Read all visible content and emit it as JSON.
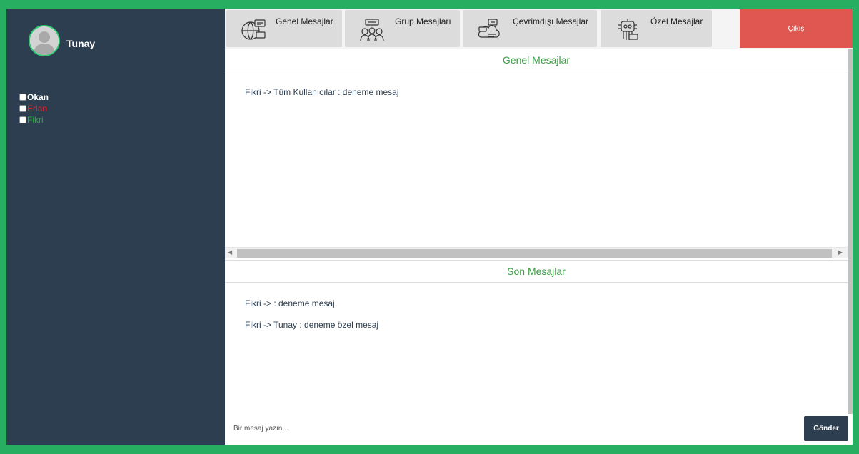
{
  "colors": {
    "page_border": "#27ae60",
    "sidebar_bg": "#2c3e50",
    "accent_green": "#3c9d46",
    "logout_red": "#e05650"
  },
  "profile": {
    "name": "Tunay",
    "avatar_icon": "user-silhouette-icon"
  },
  "users": [
    {
      "name": "Okan",
      "color": "#ffffff",
      "bold": true
    },
    {
      "name": "Erlan",
      "color": "#e8242b",
      "bold": false
    },
    {
      "name": "Fikri",
      "color": "#26b22f",
      "bold": false
    }
  ],
  "tabs": [
    {
      "label": "Genel Mesajlar",
      "icon": "globe-chat-icon"
    },
    {
      "label": "Grup Mesajları",
      "icon": "group-chat-icon"
    },
    {
      "label": "Çevrimdışı Mesajlar",
      "icon": "cloud-chat-icon"
    },
    {
      "label": "Özel Mesajlar",
      "icon": "robot-chat-icon"
    }
  ],
  "logout_label": "Çıkış",
  "general_panel": {
    "title": "Genel Mesajlar",
    "messages": [
      "Fikri -> Tüm Kullanıcılar : deneme mesaj"
    ]
  },
  "recent_panel": {
    "title": "Son Mesajlar",
    "messages": [
      "Fikri -> : deneme mesaj",
      "Fikri -> Tunay : deneme özel mesaj"
    ]
  },
  "composer": {
    "placeholder": "Bir mesaj yazın...",
    "send_label": "Gönder"
  }
}
